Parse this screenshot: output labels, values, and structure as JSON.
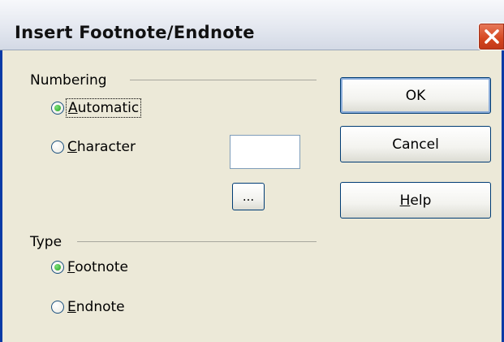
{
  "window": {
    "title": "Insert Footnote/Endnote",
    "close_icon": "close-icon"
  },
  "numbering": {
    "label": "Numbering",
    "options": [
      {
        "label_mnemonic": "A",
        "label_rest": "utomatic",
        "checked": true
      },
      {
        "label_mnemonic": "C",
        "label_rest": "haracter",
        "checked": false
      }
    ],
    "character_value": "",
    "ellipsis_label": "..."
  },
  "type": {
    "label": "Type",
    "options": [
      {
        "label_mnemonic": "F",
        "label_rest": "ootnote",
        "checked": true
      },
      {
        "label_mnemonic": "E",
        "label_rest": "ndnote",
        "checked": false
      }
    ]
  },
  "buttons": {
    "ok": "OK",
    "cancel": "Cancel",
    "help_mnemonic": "H",
    "help_rest": "elp"
  },
  "colors": {
    "dialog_bg": "#ece9d8",
    "frame_blue": "#0a3aa6",
    "close_red": "#d4461f",
    "radio_green": "#21a121"
  }
}
